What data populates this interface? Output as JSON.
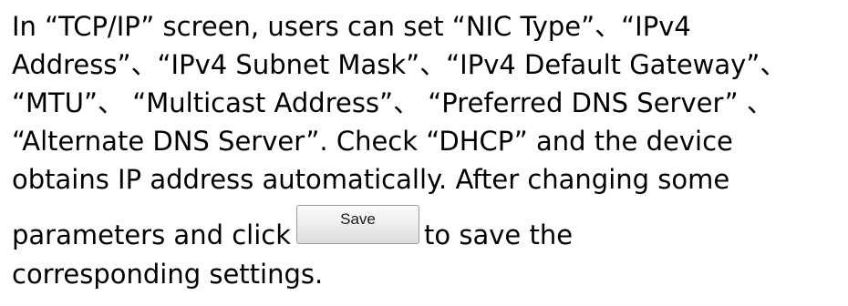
{
  "paragraph": {
    "lines": [
      "In “TCP/IP” screen, users can set “NIC Type”、“IPv4",
      "Address”、“IPv4 Subnet Mask”、“IPv4 Default Gateway”、",
      "“MTU”、 “Multicast Address”、 “Preferred DNS Server” 、",
      "“Alternate DNS Server”. Check “DHCP” and the device",
      "obtains IP address automatically. After changing some"
    ],
    "before_button": "parameters and click",
    "after_button": "to save the",
    "last_line": "corresponding settings."
  },
  "save_button": {
    "label": "Save"
  }
}
